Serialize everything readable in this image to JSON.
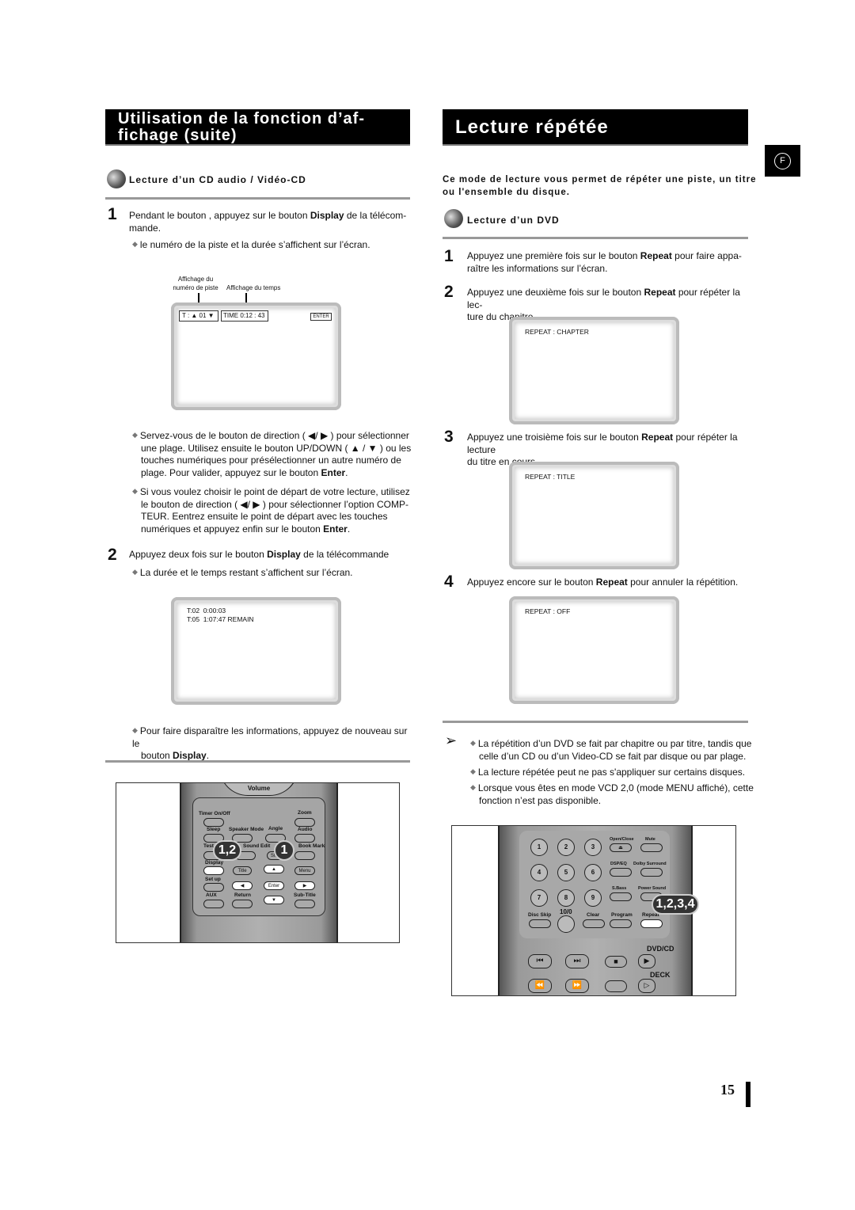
{
  "left": {
    "title_line1": "Utilisation de la fonction d’af-",
    "title_line2": "fichage (suite)",
    "subheading": "Lecture d’un CD audio / Vidéo-CD",
    "step1": {
      "number": "1",
      "text_a": "Pendant le bouton , appuyez sur le bouton ",
      "bold": "Display",
      "text_b": " de la télécom-",
      "text_c": "mande.",
      "bullet": "le numéro de la piste et la durée s’affichent sur l’écran."
    },
    "screen1": {
      "label_track_1": "Affichage du",
      "label_track_2": "numéro de piste",
      "label_time": "Affichage du temps",
      "track": "T : ▲ 01 ▼",
      "time": "TIME 0:12 : 43",
      "enter": "ENTER"
    },
    "bullet2": {
      "l1": "Servez-vous de le bouton de direction ( ◀/ ▶ ) pour sélectionner",
      "l2": "une plage. Utilisez ensuite le bouton UP/DOWN ( ▲ / ▼ ) ou les",
      "l3": "touches numériques pour présélectionner un autre numéro de",
      "l4a": "plage. Pour valider, appuyez sur le bouton ",
      "l4b": "Enter",
      "l4c": "."
    },
    "bullet3": {
      "l1": "Si vous voulez choisir le point de départ de votre lecture, utilisez",
      "l2": "le bouton de direction ( ◀/ ▶ ) pour sélectionner l’option COMP-",
      "l3": "TEUR. Eentrez ensuite le point de départ avec les touches",
      "l4a": "numériques et appuyez enfin sur le bouton ",
      "l4b": "Enter",
      "l4c": "."
    },
    "step2": {
      "number": "2",
      "text_a": "Appuyez deux fois sur le bouton ",
      "bold": "Display",
      "text_b": " de la télécommande",
      "bullet": "La durée et le temps restant s’affichent sur l’écran."
    },
    "screen2": {
      "line1": "T:02  0:00:03",
      "line2": "T:05  1:07:47 REMAIN"
    },
    "bullet4": {
      "l1": "Pour faire disparaître les informations, appuyez de nouveau sur le",
      "l2a": "bouton ",
      "l2b": "Display",
      "l2c": "."
    },
    "remote": {
      "volume": "Volume",
      "buttons": [
        "Timer On/Off",
        "Zoom",
        "Sleep",
        "Speaker Mode",
        "Angle",
        "Audio",
        "Test Tone",
        "Sound Edit",
        "Step",
        "Book Mark",
        "Display",
        "Title",
        "▲",
        "Menu",
        "Set up",
        "◀",
        "Enter",
        "▶",
        "AUX",
        "Return",
        "▼",
        "Sub-Title"
      ],
      "callout_a": "1,2",
      "callout_b": "1"
    }
  },
  "right": {
    "title": "Lecture répétée",
    "lang_badge": "F",
    "intro_l1": "Ce mode de lecture vous permet de répéter une piste, un titre",
    "intro_l2": "ou l'ensemble du disque.",
    "subheading": "Lecture d’un DVD",
    "steps": [
      {
        "number": "1",
        "a": "Appuyez une première fois sur le bouton ",
        "b": "Repeat",
        "c": " pour faire appa-",
        "d": "raître les informations sur l’écran."
      },
      {
        "number": "2",
        "a": "Appuyez une deuxième fois sur le bouton ",
        "b": "Repeat",
        "c": " pour répéter la lec-",
        "d": "ture du chapitre."
      },
      {
        "number": "3",
        "a": "Appuyez une troisième fois sur le bouton ",
        "b": "Repeat",
        "c": " pour répéter la lecture",
        "d": "du titre en cours."
      },
      {
        "number": "4",
        "a": "Appuyez encore sur le bouton ",
        "b": "Repeat",
        "c": " pour annuler la répétition.",
        "d": ""
      }
    ],
    "screens": [
      "REPEAT : CHAPTER",
      "REPEAT : TITLE",
      "REPEAT : OFF"
    ],
    "notes": [
      {
        "l1": "La répétition d’un DVD se fait par chapitre ou par titre, tandis que",
        "l2": "celle d’un CD ou d’un Video-CD se fait par disque ou par plage."
      },
      {
        "l1": "La lecture répétée peut ne pas s'appliquer sur certains disques.",
        "l2": ""
      },
      {
        "l1": "Lorsque vous êtes en mode VCD 2,0 (mode MENU affiché), cette",
        "l2": "fonction n’est pas disponible."
      }
    ],
    "remote": {
      "digits": [
        "1",
        "2",
        "3",
        "4",
        "5",
        "6",
        "7",
        "8",
        "9"
      ],
      "labels": [
        "Open/Close",
        "Mute",
        "DSP/EQ",
        "Dolby Surround",
        "S.Bass",
        "Power Sound",
        "Disc Skip",
        "10/0",
        "Clear",
        "Program",
        "Repeat",
        "DVD/CD",
        "DECK"
      ],
      "callout": "1,2,3,4"
    }
  },
  "page_number": "15"
}
